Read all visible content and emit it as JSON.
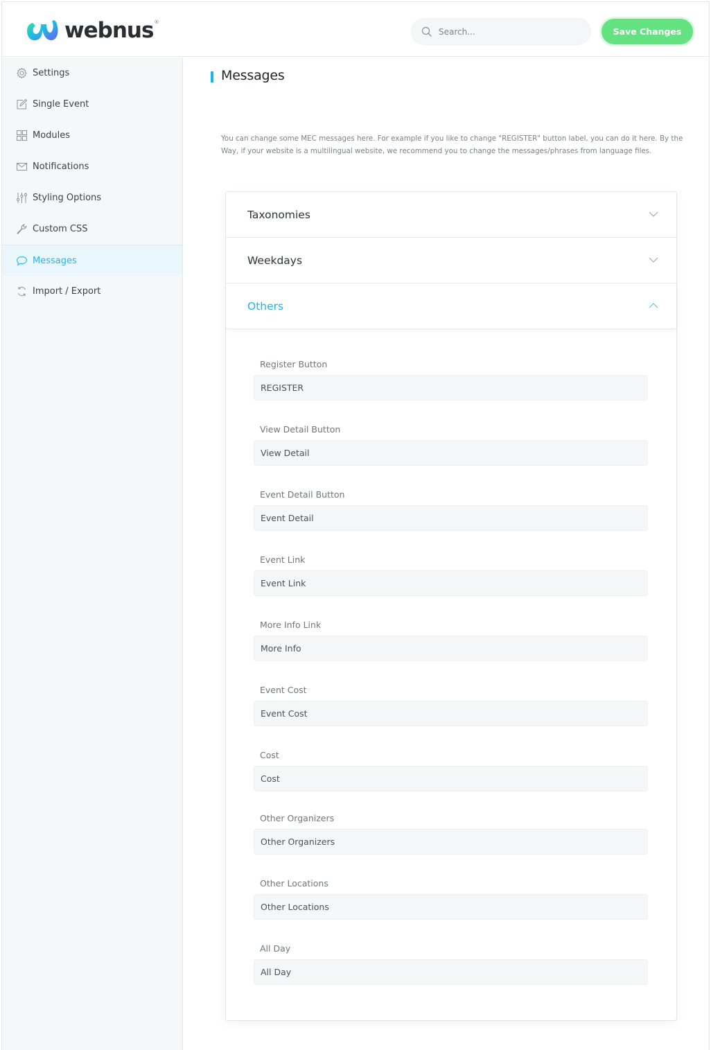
{
  "header": {
    "brand": "webnus",
    "brand_mark": "®",
    "search": {
      "placeholder": "Search...",
      "value": ""
    },
    "save_label": "Save Changes",
    "colors": {
      "save": "#64e281",
      "accent": "#26b5e5"
    }
  },
  "sidebar": {
    "items": [
      {
        "label": "Settings",
        "icon": "gear-icon",
        "active": false
      },
      {
        "label": "Single Event",
        "icon": "edit-icon",
        "active": false
      },
      {
        "label": "Modules",
        "icon": "grid-icon",
        "active": false
      },
      {
        "label": "Notifications",
        "icon": "envelope-icon",
        "active": false
      },
      {
        "label": "Styling Options",
        "icon": "sliders-icon",
        "active": false
      },
      {
        "label": "Custom CSS",
        "icon": "wrench-icon",
        "active": false
      },
      {
        "label": "Messages",
        "icon": "speech-bubble-icon",
        "active": true
      },
      {
        "label": "Import / Export",
        "icon": "refresh-icon",
        "active": false
      }
    ]
  },
  "main": {
    "title": "Messages",
    "description": "You can change some MEC messages here. For example if you like to change \"REGISTER\" button label, you can do it here. By the Way, if your website is a multilingual website, we recommend you to change the messages/phrases from language files.",
    "sections": [
      {
        "label": "Taxonomies",
        "expanded": false
      },
      {
        "label": "Weekdays",
        "expanded": false
      },
      {
        "label": "Others",
        "expanded": true
      }
    ],
    "fields": [
      {
        "label": "Register Button",
        "value": "REGISTER"
      },
      {
        "label": "View Detail Button",
        "value": "View Detail"
      },
      {
        "label": "Event Detail Button",
        "value": "Event Detail"
      },
      {
        "label": "Event Link",
        "value": "Event Link"
      },
      {
        "label": "More Info Link",
        "value": "More Info"
      },
      {
        "label": "Event Cost",
        "value": "Event Cost"
      },
      {
        "label": "Cost",
        "value": "Cost"
      },
      {
        "label": "Other Organizers",
        "value": "Other Organizers"
      },
      {
        "label": "Other Locations",
        "value": "Other Locations"
      },
      {
        "label": "All Day",
        "value": "All Day"
      }
    ]
  }
}
